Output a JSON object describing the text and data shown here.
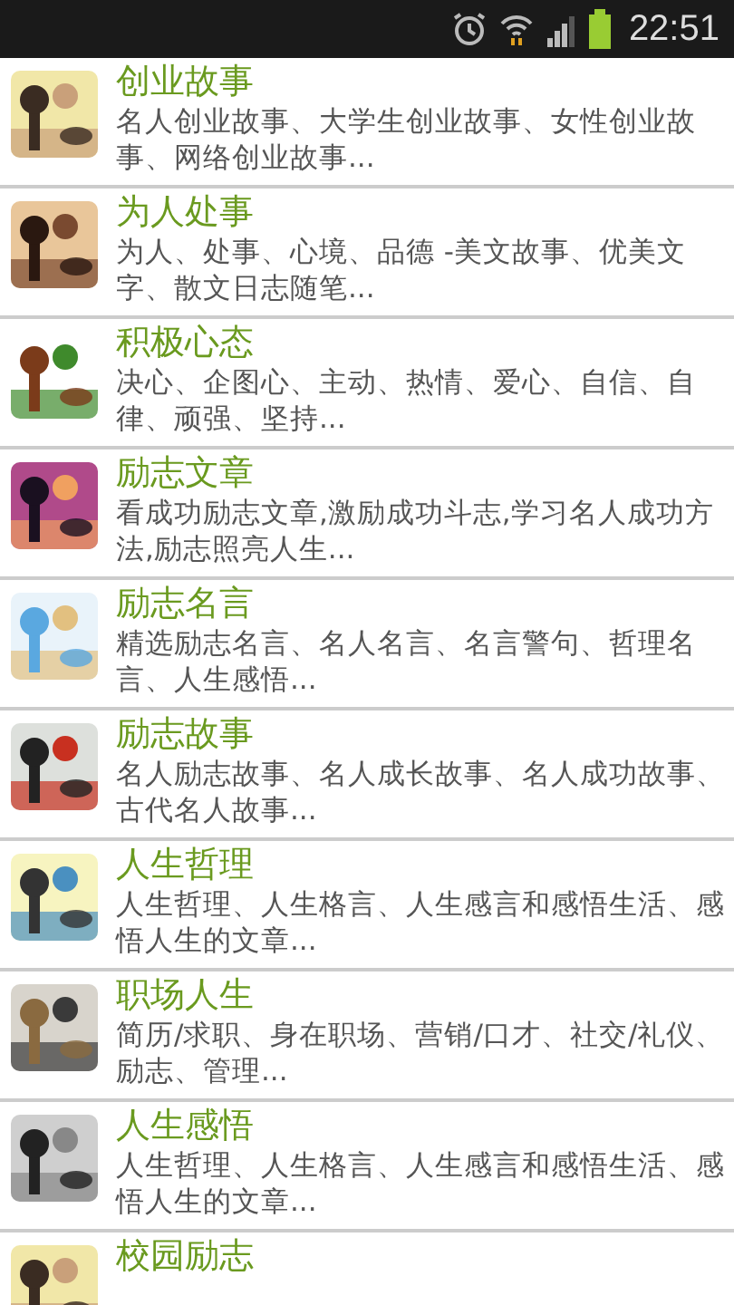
{
  "status_bar": {
    "time": "22:51"
  },
  "items": [
    {
      "title": "创业故事",
      "description": "名人创业故事、大学生创业故事、女性创业故事、网络创业故事..."
    },
    {
      "title": "为人处事",
      "description": "为人、处事、心境、品德 -美文故事、优美文字、散文日志随笔..."
    },
    {
      "title": "积极心态",
      "description": "决心、企图心、主动、热情、爱心、自信、自律、顽强、坚持..."
    },
    {
      "title": "励志文章",
      "description": "看成功励志文章,激励成功斗志,学习名人成功方法,励志照亮人生..."
    },
    {
      "title": "励志名言",
      "description": "精选励志名言、名人名言、名言警句、哲理名言、人生感悟..."
    },
    {
      "title": "励志故事",
      "description": "名人励志故事、名人成长故事、名人成功故事、古代名人故事..."
    },
    {
      "title": "人生哲理",
      "description": "人生哲理、人生格言、人生感言和感悟生活、感悟人生的文章..."
    },
    {
      "title": "职场人生",
      "description": "简历/求职、身在职场、营销/口才、社交/礼仪、励志、管理..."
    },
    {
      "title": "人生感悟",
      "description": "人生哲理、人生格言、人生感言和感悟生活、感悟人生的文章..."
    },
    {
      "title": "校园励志"
    }
  ]
}
